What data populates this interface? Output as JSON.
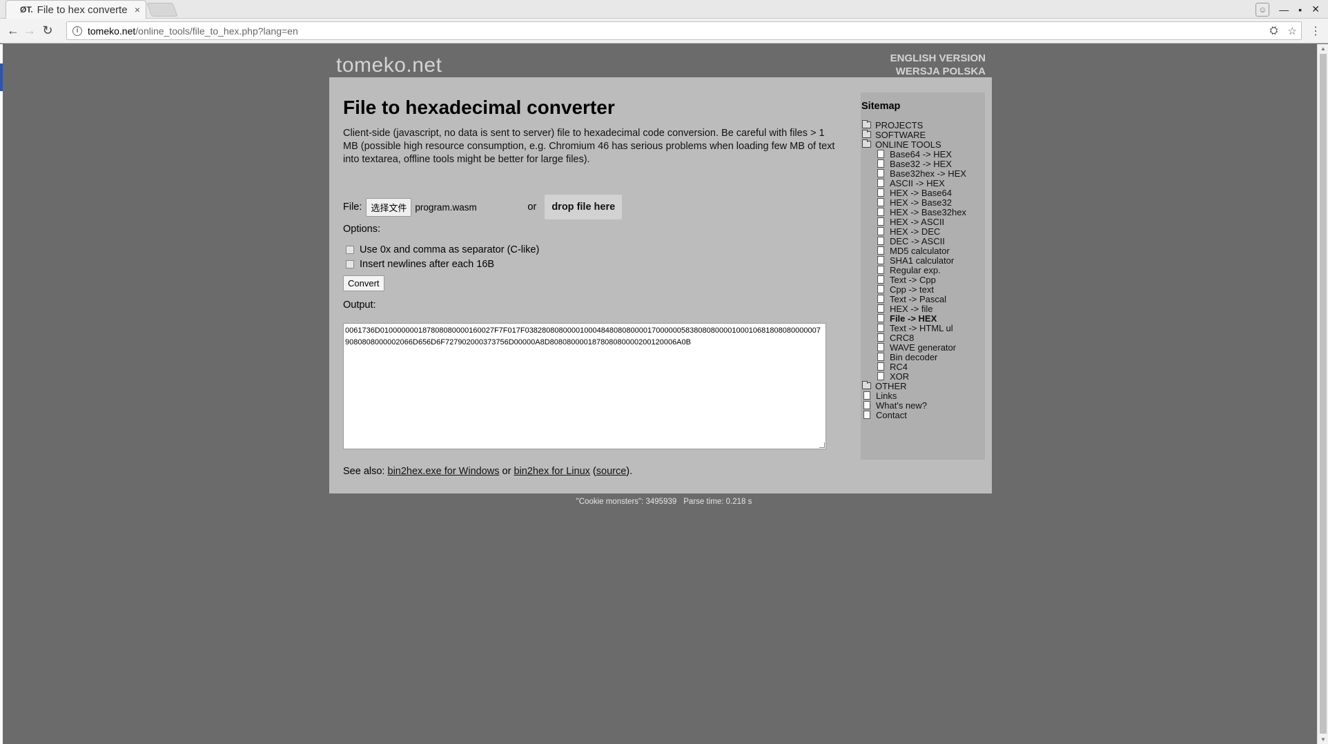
{
  "browser": {
    "tab_favicon": "ØT.",
    "tab_title": "File to hex converte",
    "tab_close": "×",
    "url_host": "tomeko.net",
    "url_path": "/online_tools/file_to_hex.php?lang=en"
  },
  "header": {
    "logo": "tomeko.net",
    "english": "ENGLISH VERSION",
    "polish": "WERSJA POLSKA"
  },
  "main": {
    "title": "File to hexadecimal converter",
    "description": "Client-side (javascript, no data is sent to server) file to hexadecimal code conversion. Be careful with files > 1 MB (possible high resource consumption, e.g. Chromium 46 has serious problems when loading few MB of text into textarea, offline tools might be better for large files).",
    "file_label": "File:",
    "choose_file": "选择文件",
    "file_name": "program.wasm",
    "or_label": "or",
    "drop_zone": "drop file here",
    "options_label": "Options:",
    "option_separator": "Use 0x and comma as separator (C-like)",
    "option_newlines": "Insert newlines after each 16B",
    "convert_button": "Convert",
    "output_label": "Output:",
    "output_value": "0061736D010000000187808080000160027F7F017F03828080800001000484808080000170000005838080800001000106818080800000079080808000002066D656D6F727902000373756D00000A8D808080000187808080000200120006A0B",
    "see_also_prefix": "See also: ",
    "link_windows": "bin2hex.exe for Windows",
    "see_also_or": " or ",
    "link_linux": "bin2hex for Linux",
    "paren_open": " (",
    "link_source": "source",
    "paren_close": ")."
  },
  "sitemap": {
    "title": "Sitemap",
    "top_items": [
      "PROJECTS",
      "SOFTWARE",
      "ONLINE TOOLS"
    ],
    "tools": [
      "Base64 -> HEX",
      "Base32 -> HEX",
      "Base32hex -> HEX",
      "ASCII -> HEX",
      "HEX -> Base64",
      "HEX -> Base32",
      "HEX -> Base32hex",
      "HEX -> ASCII",
      "HEX -> DEC",
      "DEC -> ASCII",
      "MD5 calculator",
      "SHA1 calculator",
      "Regular exp.",
      "Text -> Cpp",
      "Cpp -> text",
      "Text -> Pascal",
      "HEX -> file",
      "File -> HEX",
      "Text -> HTML ul",
      "CRC8",
      "WAVE generator",
      "Bin decoder",
      "RC4",
      "XOR"
    ],
    "active_tool": "File -> HEX",
    "bottom_items": [
      "OTHER",
      "Links",
      "What's new?",
      "Contact"
    ]
  },
  "footer": {
    "cookie": "\"Cookie monsters\": 3495939",
    "parse": "Parse time: 0.218 s"
  }
}
